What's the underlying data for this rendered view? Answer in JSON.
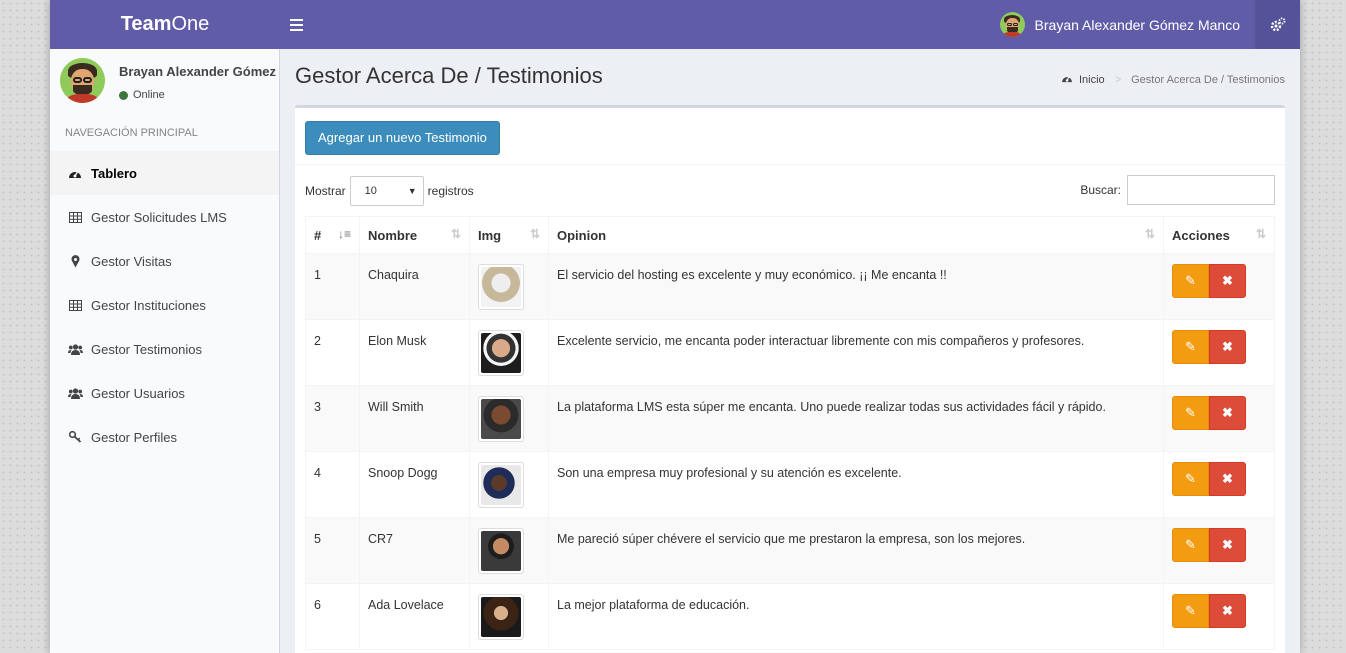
{
  "app": {
    "logo_bold": "Team",
    "logo_rest": "One"
  },
  "header": {
    "user_name": "Brayan Alexander Gómez Manco"
  },
  "sidebar": {
    "user_name": "Brayan Alexander Gómez M",
    "status": "Online",
    "nav_header": "NAVEGACIÓN PRINCIPAL",
    "items": [
      {
        "label": "Tablero",
        "icon": "dashboard-icon"
      },
      {
        "label": "Gestor Solicitudes LMS",
        "icon": "table-icon"
      },
      {
        "label": "Gestor Visitas",
        "icon": "map-marker-icon"
      },
      {
        "label": "Gestor Instituciones",
        "icon": "table-icon"
      },
      {
        "label": "Gestor Testimonios",
        "icon": "users-icon"
      },
      {
        "label": "Gestor Usuarios",
        "icon": "users-icon"
      },
      {
        "label": "Gestor Perfiles",
        "icon": "key-icon"
      }
    ]
  },
  "page": {
    "title": "Gestor Acerca De / Testimonios",
    "breadcrumb": {
      "home": "Inicio",
      "current": "Gestor Acerca De / Testimonios"
    }
  },
  "box": {
    "add_button": "Agregar un nuevo Testimonio",
    "show_prefix": "Mostrar",
    "show_value": "10",
    "show_suffix": "registros",
    "search_label": "Buscar:"
  },
  "table": {
    "columns": [
      "#",
      "Nombre",
      "Img",
      "Opinion",
      "Acciones"
    ],
    "rows": [
      {
        "id": "1",
        "name": "Chaquira",
        "opinion": "El servicio del hosting es excelente y muy económico. ¡¡ Me encanta !!"
      },
      {
        "id": "2",
        "name": "Elon Musk",
        "opinion": "Excelente servicio, me encanta poder interactuar libremente con mis compañeros y profesores."
      },
      {
        "id": "3",
        "name": "Will Smith",
        "opinion": "La plataforma LMS esta súper me encanta. Uno puede realizar todas sus actividades fácil y rápido."
      },
      {
        "id": "4",
        "name": "Snoop Dogg",
        "opinion": "Son una empresa muy profesional y su atención es excelente."
      },
      {
        "id": "5",
        "name": "CR7",
        "opinion": "Me pareció súper chévere el servicio que me prestaron la empresa, son los mejores."
      },
      {
        "id": "6",
        "name": "Ada Lovelace",
        "opinion": "La mejor plataforma de educación."
      }
    ]
  },
  "colors": {
    "header_bg": "#605ca8",
    "primary_button": "#3c8dbc",
    "edit_button": "#f39c12",
    "delete_button": "#dd4b39"
  }
}
